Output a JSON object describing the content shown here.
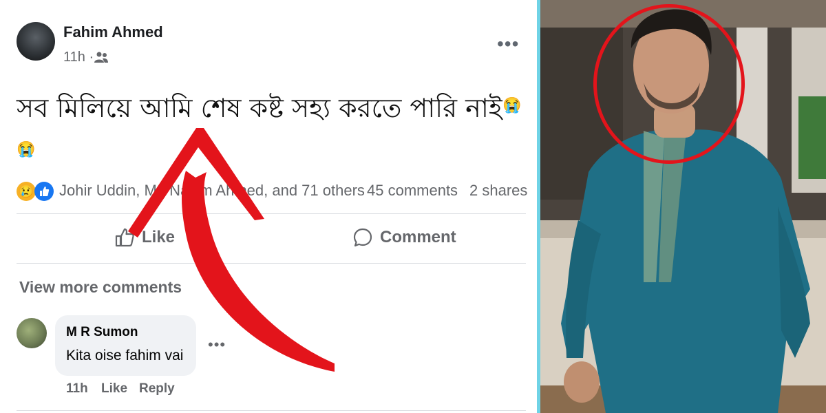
{
  "post": {
    "author": "Fahim Ahmed",
    "time": "11h ·",
    "text": "সব মিলিয়ে আমি শেষ কষ্ট সহ্য করতে পারি নাই",
    "reaction_names": "Johir Uddin, Md Nazim Ahmed, and 71 others",
    "comments_count": "45 comments",
    "shares_count": "2 shares",
    "like_label": "Like",
    "comment_label": "Comment"
  },
  "comments": {
    "view_more": "View more comments",
    "items": [
      {
        "author": "M R Sumon",
        "text": "Kita oise fahim vai",
        "time": "11h",
        "like": "Like",
        "reply": "Reply"
      }
    ]
  },
  "colors": {
    "annotation_red": "#e3141b",
    "panel_border": "#6fd3e6",
    "shirt_teal": "#1f6f86"
  },
  "icons": [
    "friends-icon",
    "more-options-icon",
    "like-icon",
    "comment-icon",
    "crying-emoji-icon",
    "sad-reaction-icon",
    "like-reaction-icon"
  ]
}
